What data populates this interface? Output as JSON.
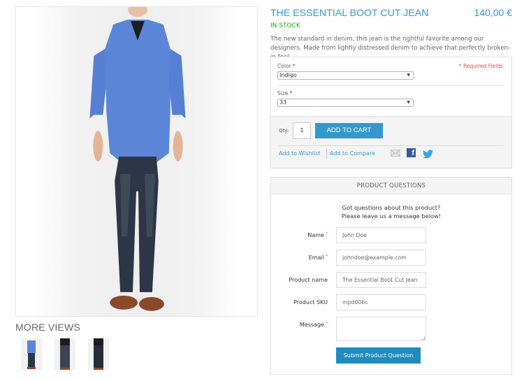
{
  "product": {
    "title": "THE ESSENTIAL BOOT CUT JEAN",
    "price": "140,00 €",
    "availability": "IN STOCK",
    "description": "The new standard in denim, this jean is the rightful favorite among our designers. Made from lightly distressed denim to achieve that perfectly broken-in feel."
  },
  "gallery": {
    "main_image_alt": "Model wearing blue shirt and boot cut jeans",
    "more_views_title": "MORE VIEWS",
    "thumbnails": [
      "front-with-shirt",
      "front-jeans",
      "back-jeans"
    ]
  },
  "options": {
    "required_note": "* Required Fields",
    "color": {
      "label": "Color",
      "required_mark": "*",
      "selected": "Indigo"
    },
    "size": {
      "label": "Size",
      "required_mark": "*",
      "selected": "33"
    }
  },
  "cart": {
    "qty_label": "Qty:",
    "qty_value": "1",
    "add_to_cart": "ADD TO CART",
    "wishlist": "Add to Wishlist",
    "compare": "Add to Compare",
    "share_icons": [
      "email-icon",
      "facebook-icon",
      "twitter-icon"
    ]
  },
  "questions": {
    "header": "PRODUCT QUESTIONS",
    "intro_line1": "Got questions about this product?",
    "intro_line2": "Please leave us a message below!",
    "fields": [
      {
        "label": "Name",
        "required": true,
        "value": "John Doe"
      },
      {
        "label": "Email",
        "required": true,
        "value": "johndoe@example.com"
      },
      {
        "label": "Product name",
        "required": false,
        "value": "The Essential Boot Cut Jean"
      },
      {
        "label": "Product SKU",
        "required": false,
        "value": "mpd006c"
      },
      {
        "label": "Message",
        "required": true,
        "value": ""
      }
    ],
    "required_mark": "*",
    "submit": "Submit Product Question"
  },
  "colors": {
    "accent": "#3399cc",
    "in_stock": "#11b400",
    "required": "#df280a",
    "submit": "#1e8cbc"
  }
}
